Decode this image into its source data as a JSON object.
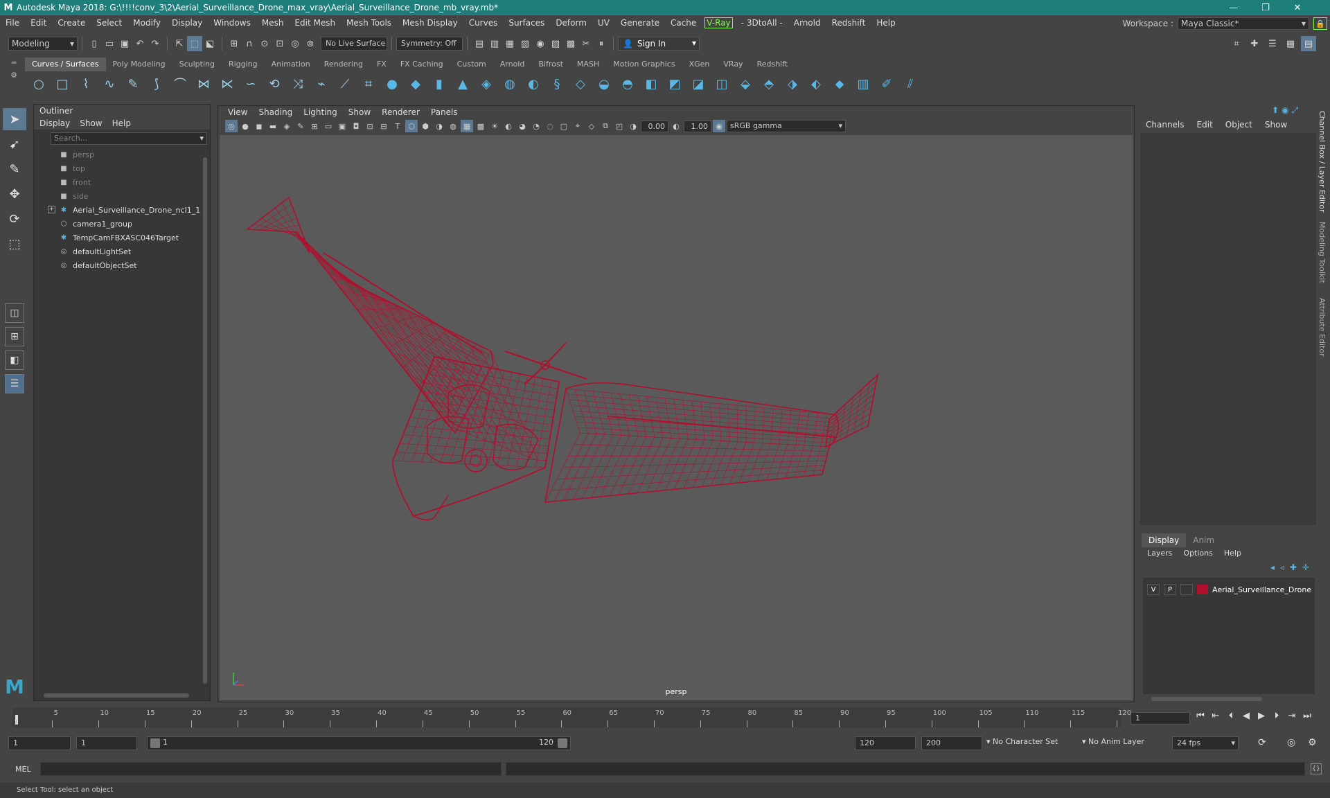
{
  "window": {
    "title": "Autodesk Maya 2018: G:\\!!!!conv_3\\2\\Aerial_Surveillance_Drone_max_vray\\Aerial_Surveillance_Drone_mb_vray.mb*",
    "app_letter": "M",
    "minimize": "—",
    "maximize": "❐",
    "close": "✕"
  },
  "menubar": {
    "items": [
      "File",
      "Edit",
      "Create",
      "Select",
      "Modify",
      "Display",
      "Windows",
      "Mesh",
      "Edit Mesh",
      "Mesh Tools",
      "Mesh Display",
      "Curves",
      "Surfaces",
      "Deform",
      "UV",
      "Generate",
      "Cache"
    ],
    "vray": "V-Ray",
    "items2": [
      "- 3DtoAll -",
      "Arnold",
      "Redshift",
      "Help"
    ]
  },
  "workspace": {
    "label": "Workspace :",
    "value": "Maya Classic*"
  },
  "statusline": {
    "mode": "Modeling",
    "live_surface": "No Live Surface",
    "symmetry": "Symmetry: Off",
    "sign_in": "Sign In"
  },
  "shelf": {
    "tabs": [
      "Curves / Surfaces",
      "Poly Modeling",
      "Sculpting",
      "Rigging",
      "Animation",
      "Rendering",
      "FX",
      "FX Caching",
      "Custom",
      "Arnold",
      "Bifrost",
      "MASH",
      "Motion Graphics",
      "XGen",
      "VRay",
      "Redshift"
    ],
    "active_tab": 0
  },
  "outliner": {
    "title": "Outliner",
    "menu": [
      "Display",
      "Show",
      "Help"
    ],
    "search_placeholder": "Search...",
    "items": [
      {
        "label": "persp",
        "icon": "camera-icon",
        "dim": true,
        "expand": false
      },
      {
        "label": "top",
        "icon": "camera-icon",
        "dim": true,
        "expand": false
      },
      {
        "label": "front",
        "icon": "camera-icon",
        "dim": true,
        "expand": false
      },
      {
        "label": "side",
        "icon": "camera-icon",
        "dim": true,
        "expand": false
      },
      {
        "label": "Aerial_Surveillance_Drone_ncl1_1",
        "icon": "transform-icon",
        "dim": false,
        "expand": true
      },
      {
        "label": "camera1_group",
        "icon": "group-icon",
        "dim": false,
        "expand": false
      },
      {
        "label": "TempCamFBXASC046Target",
        "icon": "transform-icon",
        "dim": false,
        "expand": false
      },
      {
        "label": "defaultLightSet",
        "icon": "set-icon",
        "dim": false,
        "expand": false
      },
      {
        "label": "defaultObjectSet",
        "icon": "set-icon",
        "dim": false,
        "expand": false
      }
    ]
  },
  "viewport": {
    "menu": [
      "View",
      "Shading",
      "Lighting",
      "Show",
      "Renderer",
      "Panels"
    ],
    "exposure": "0.00",
    "gamma": "1.00",
    "color_space": "sRGB gamma",
    "camera": "persp",
    "wire_color": "#b0102e",
    "background": "#5a5a5a"
  },
  "channelbox": {
    "menu": [
      "Channels",
      "Edit",
      "Object",
      "Show"
    ],
    "side_tabs": [
      "Channel Box / Layer Editor",
      "Modeling Toolkit",
      "Attribute Editor"
    ]
  },
  "layers": {
    "tabs": [
      "Display",
      "Anim"
    ],
    "menu": [
      "Layers",
      "Options",
      "Help"
    ],
    "rows": [
      {
        "v": "V",
        "p": "P",
        "name": "Aerial_Surveillance_Drone",
        "color": "#b0102e"
      }
    ]
  },
  "timeline": {
    "ticks": [
      5,
      10,
      15,
      20,
      25,
      30,
      35,
      40,
      45,
      50,
      55,
      60,
      65,
      70,
      75,
      80,
      85,
      90,
      95,
      100,
      105,
      110,
      115,
      120
    ],
    "range_start": 1,
    "range_end": 120,
    "current_frame": "1",
    "current_marker": "1"
  },
  "range": {
    "start": "1",
    "playback_start": "1",
    "slider_start": "1",
    "slider_end": "120",
    "playback_end": "120",
    "end": "200",
    "character_set": "No Character Set",
    "anim_layer": "No Anim Layer",
    "fps": "24 fps"
  },
  "cmdline": {
    "label": "MEL"
  },
  "helpline": {
    "text": "Select Tool: select an object"
  }
}
